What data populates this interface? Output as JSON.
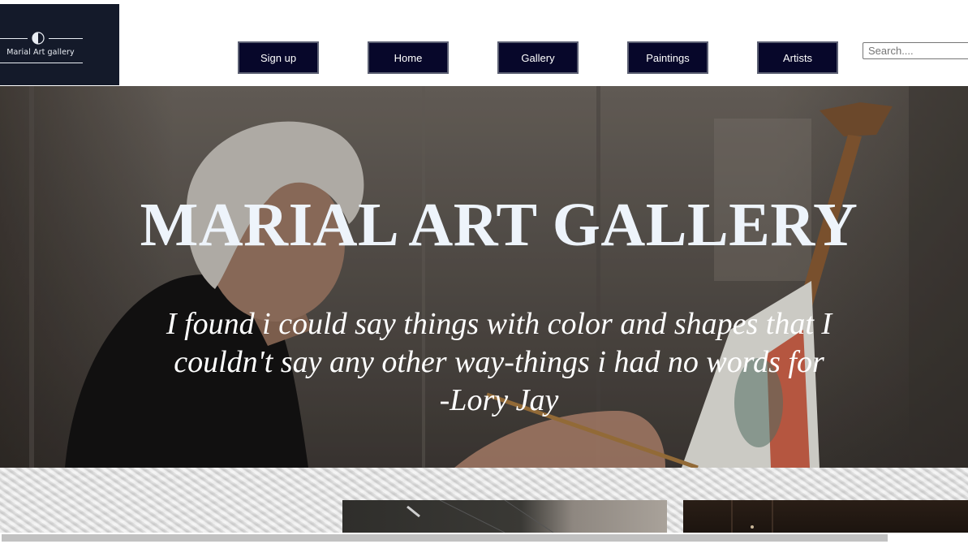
{
  "logo": {
    "text": "Marial Art gallery",
    "icon": "half-circle-logo-icon"
  },
  "nav": {
    "items": [
      {
        "label": "Sign up"
      },
      {
        "label": "Home"
      },
      {
        "label": "Gallery"
      },
      {
        "label": "Paintings"
      },
      {
        "label": "Artists"
      }
    ]
  },
  "search": {
    "placeholder": "Search....",
    "value": ""
  },
  "hero": {
    "title": "MARIAL ART GALLERY",
    "quote_line1": "I found i could say things with color and shapes that I",
    "quote_line2": "couldn't say any other way-things i had no words for",
    "quote_author": "-Lory Jay"
  },
  "colors": {
    "header_bg": "#ffffff",
    "logo_bg": "#141a2a",
    "nav_button_bg": "#07072a",
    "hero_title": "#eef4fb"
  }
}
